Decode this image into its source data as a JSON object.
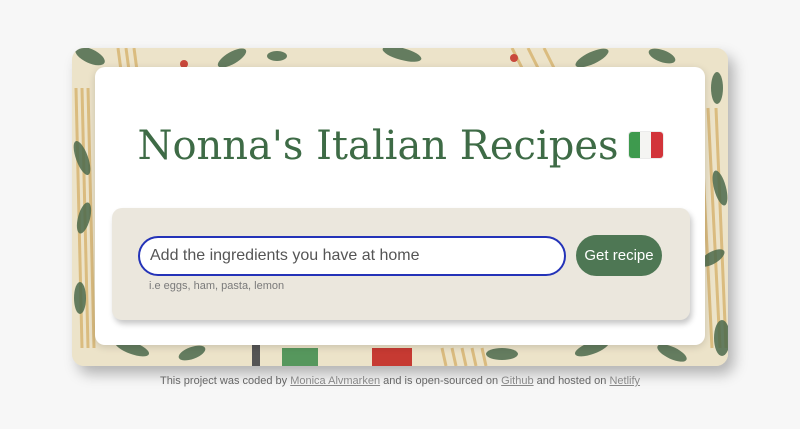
{
  "colors": {
    "title": "#3e6b46",
    "button": "#4e7754",
    "input_border": "#2433b8",
    "panel": "#ebe7dd",
    "flag_green": "#3e9a4e",
    "flag_white": "#f4f4f2",
    "flag_red": "#d2343a"
  },
  "header": {
    "title": "Nonna's Italian Recipes",
    "flag_icon": "italy-flag-icon"
  },
  "search": {
    "placeholder": "Add the ingredients you have at home",
    "value": "",
    "hint": "i.e eggs, ham, pasta, lemon",
    "button_label": "Get recipe"
  },
  "footer": {
    "text_1": "This project was coded by",
    "author_link": "Monica Alvmarken",
    "text_2": "and is open-sourced on",
    "github_link": "Github",
    "text_3": "and hosted on",
    "netlify_link": "Netlify"
  }
}
